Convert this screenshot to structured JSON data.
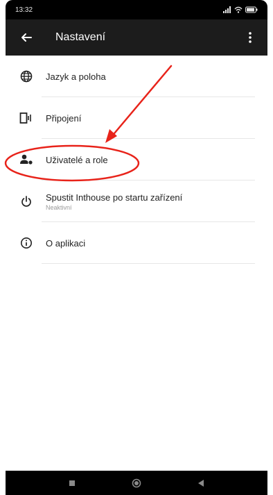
{
  "status_bar": {
    "time": "13:32"
  },
  "app_bar": {
    "title": "Nastavení",
    "back_icon": "arrow-back-icon",
    "menu_icon": "more-vert-icon"
  },
  "settings": {
    "items": [
      {
        "label": "Jazyk a poloha",
        "icon": "globe-icon"
      },
      {
        "label": "Připojení",
        "icon": "connection-icon"
      },
      {
        "label": "Uživatelé a role",
        "icon": "users-roles-icon"
      },
      {
        "label": "Spustit Inthouse po startu zařízení",
        "sublabel": "Neaktivní",
        "icon": "power-icon"
      },
      {
        "label": "O aplikaci",
        "icon": "info-icon"
      }
    ]
  },
  "annotation": {
    "color": "#e8231a"
  },
  "nav_bar": {
    "buttons": [
      "recent-apps-icon",
      "home-icon",
      "back-triangle-icon"
    ]
  }
}
